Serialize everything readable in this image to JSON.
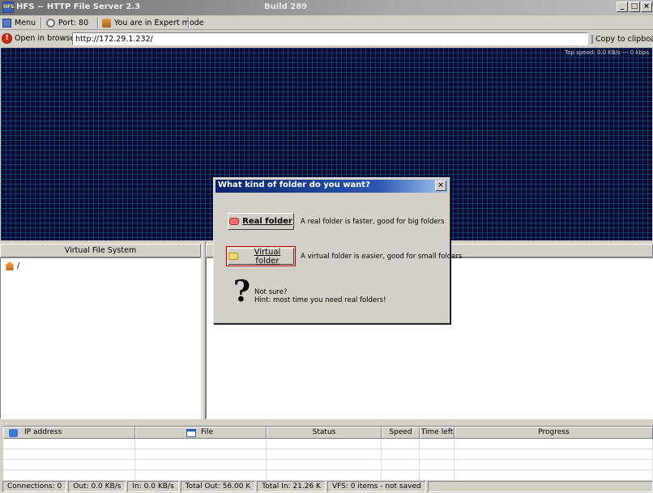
{
  "window": {
    "title": "HFS ~ HTTP File Server 2.3",
    "build": "Build 289",
    "minimize": "_",
    "maximize": "□",
    "close": "×"
  },
  "toolbar": {
    "menu_label": "Menu",
    "port_label": "Port: 80",
    "mode_label": "You are in Expert mode"
  },
  "address": {
    "open_label": "Open in browser",
    "url": "http://172.29.1.232/",
    "copy_label": "Copy to clipboard"
  },
  "graph": {
    "speed_text": "Top speed: 0.0 KB/s --- 0 kbps"
  },
  "vfs": {
    "header": "Virtual File System",
    "root_label": "/"
  },
  "connections": {
    "columns": [
      "IP address",
      "File",
      "Status",
      "Speed",
      "Time left",
      "Progress"
    ],
    "rows": 4
  },
  "statusbar": {
    "items": [
      "Connections: 0",
      "Out: 0.0 KB/s",
      "In: 0.0 KB/s",
      "Total Out: 56.00 K",
      "Total In: 21.26 K",
      "VFS: 0 items - not saved"
    ]
  },
  "dialog": {
    "title": "What kind of folder do you want?",
    "close": "×",
    "real_label": "Real folder",
    "real_desc": "A real folder is faster, good for big folders",
    "virtual_label": "Virtual folder",
    "virtual_desc": "A virtual folder is easier, good for small folders",
    "qmark": "?",
    "hint_line1": "Not sure?",
    "hint_line2": "Hint: most time you need real folders!"
  },
  "colors": {
    "graph_bg": "#0b0b35",
    "title_gradient_start": "#0a246a",
    "focus_outline": "#c00000"
  }
}
